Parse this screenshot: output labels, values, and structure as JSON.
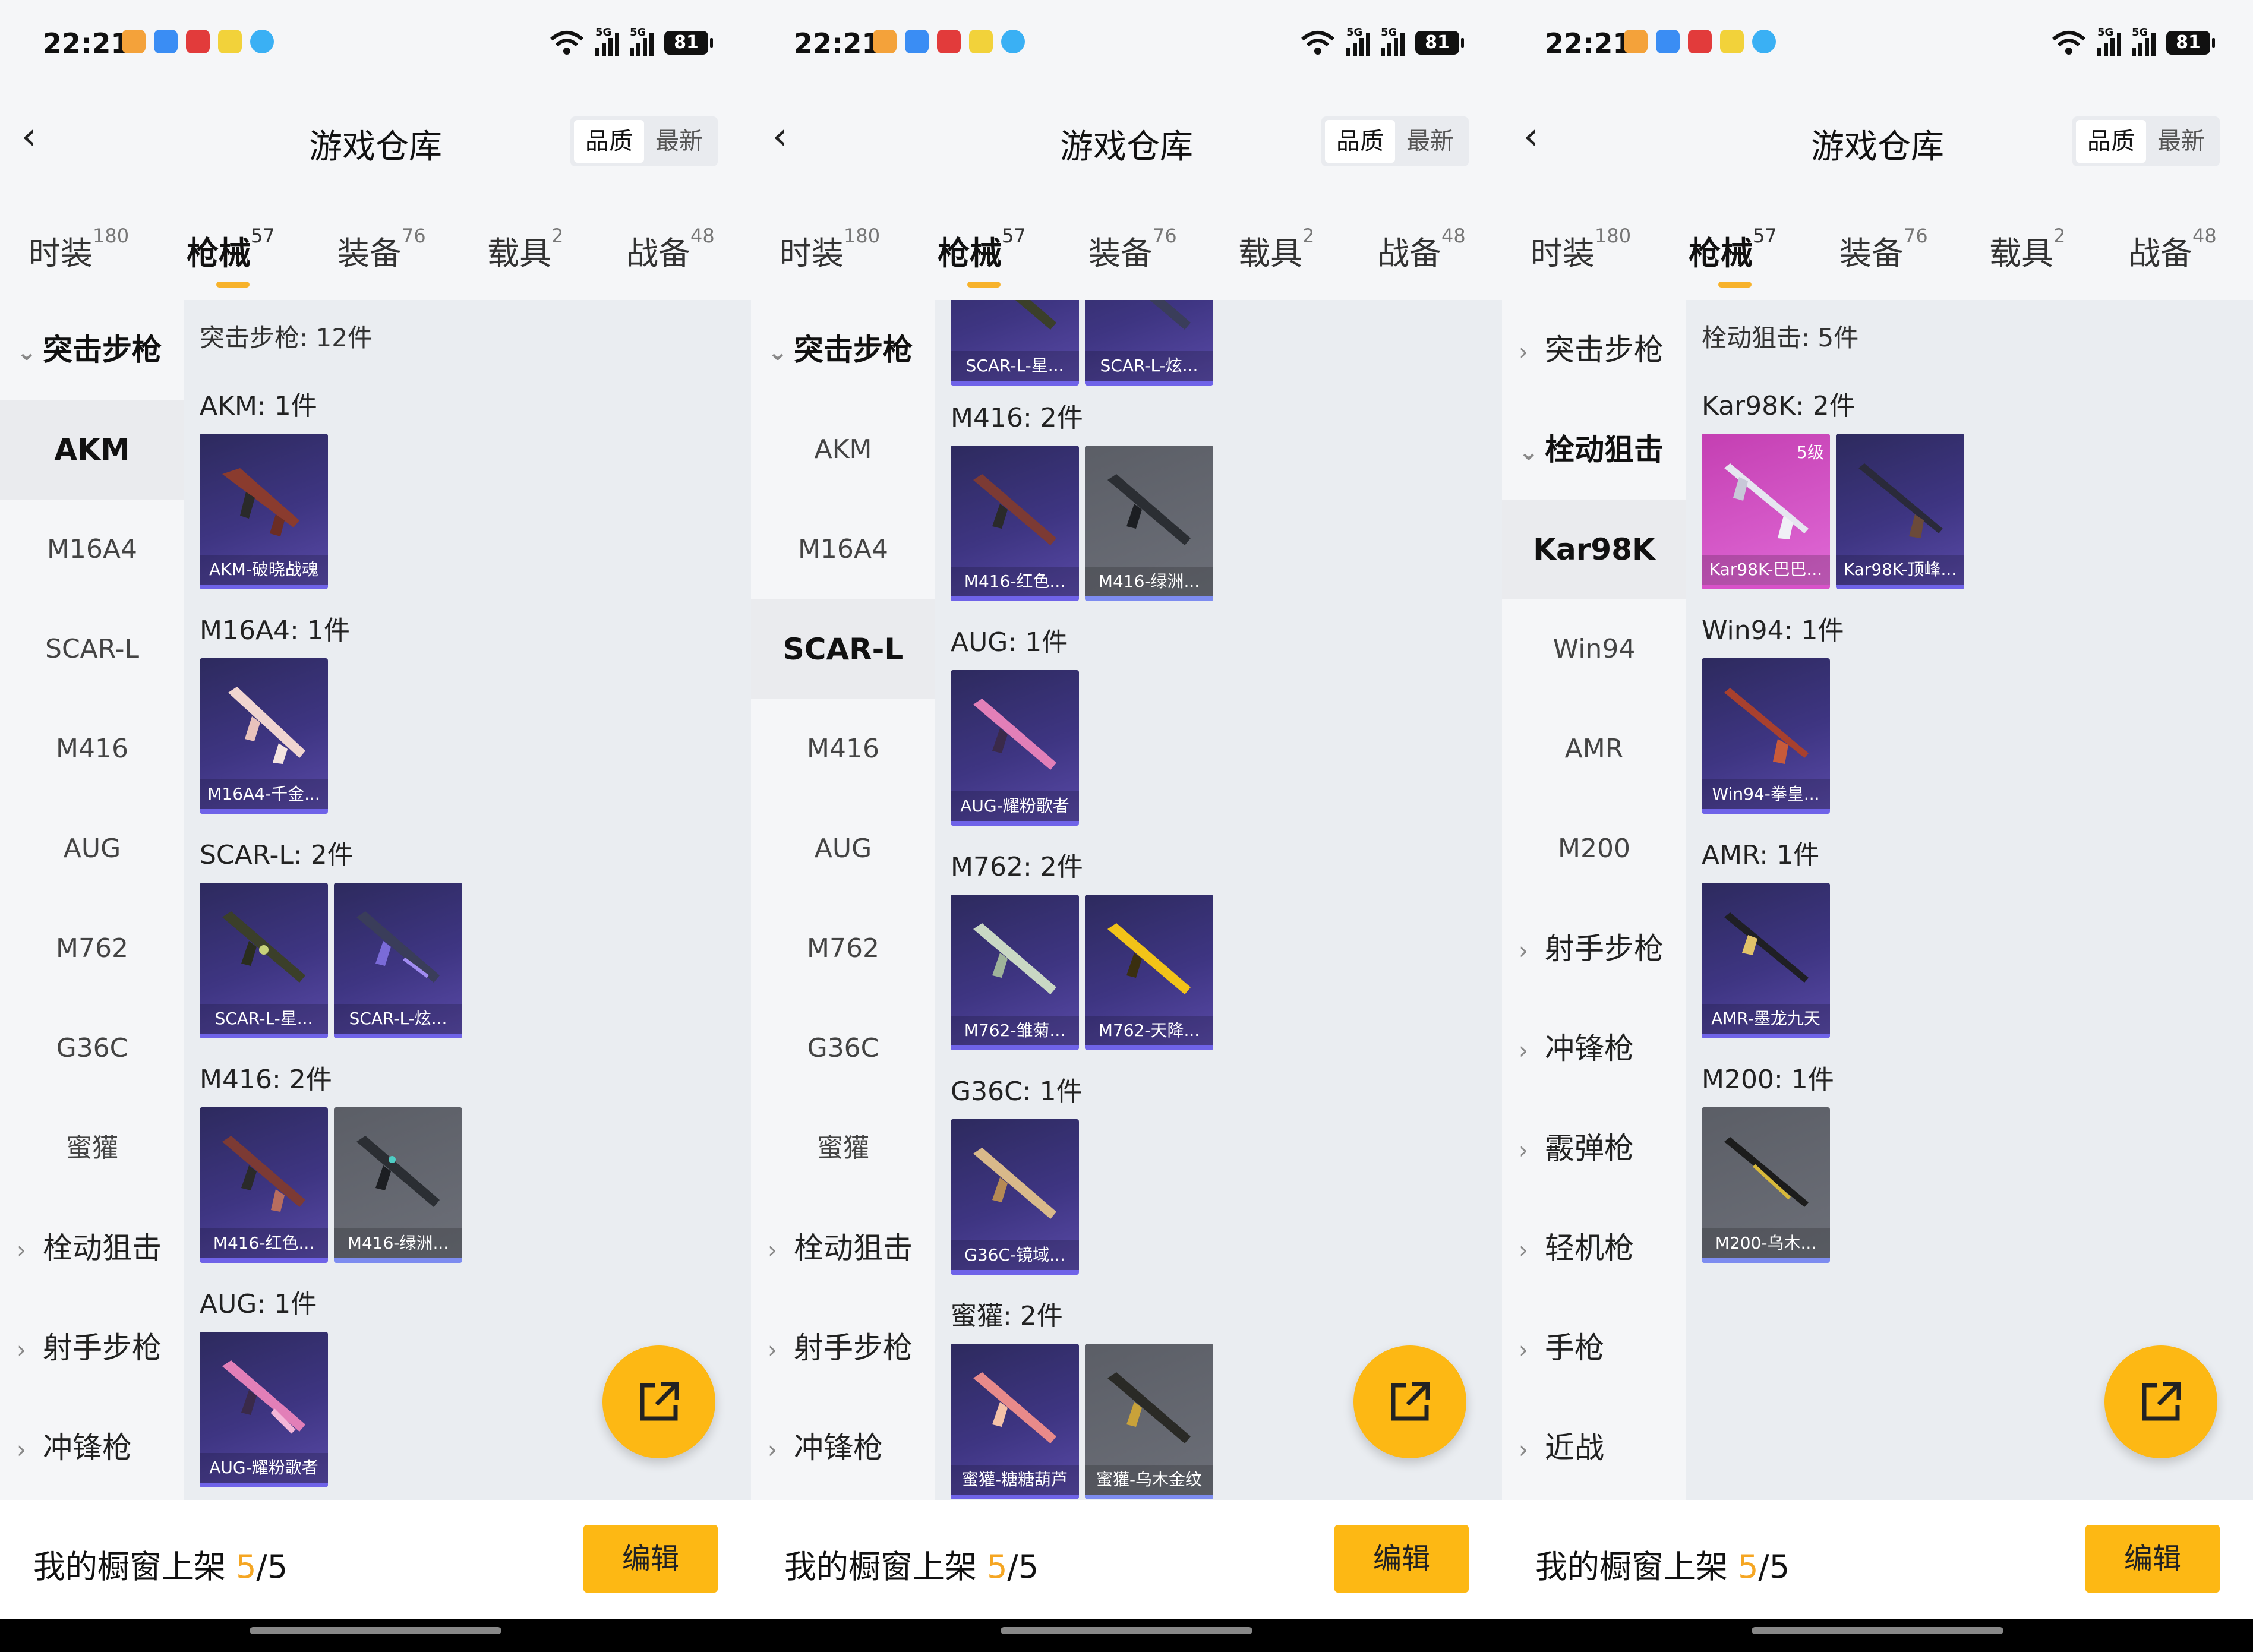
{
  "status": {
    "time": "22:21",
    "battery": "81",
    "signal": "5G"
  },
  "header": {
    "back": "‹",
    "title": "游戏仓库",
    "sort_quality": "品质",
    "sort_latest": "最新"
  },
  "tabs": [
    {
      "label": "时装",
      "count": "180"
    },
    {
      "label": "枪械",
      "count": "57"
    },
    {
      "label": "装备",
      "count": "76"
    },
    {
      "label": "载具",
      "count": "2"
    },
    {
      "label": "战备",
      "count": "48"
    }
  ],
  "colors": {
    "accent": "#fdb814",
    "card_bg": "#3e3582",
    "card_grey": "#6c6f78",
    "card_pink": "#d852c9"
  },
  "bottom": {
    "prefix": "我的橱窗上架 ",
    "count": "5",
    "total": "/5",
    "edit": "编辑"
  },
  "panels": [
    {
      "sidebar": [
        {
          "label": "突击步枪",
          "arrow": "⌄"
        },
        {
          "label": "AKM"
        },
        {
          "label": "M16A4"
        },
        {
          "label": "SCAR-L"
        },
        {
          "label": "M416"
        },
        {
          "label": "AUG"
        },
        {
          "label": "M762"
        },
        {
          "label": "G36C"
        },
        {
          "label": "蜜獾"
        },
        {
          "label": "栓动狙击",
          "arrow": "›"
        },
        {
          "label": "射手步枪",
          "arrow": "›"
        },
        {
          "label": "冲锋枪",
          "arrow": "›"
        }
      ],
      "section": "突击步枪: 12件",
      "groups": [
        {
          "label": "AKM: 1件",
          "items": [
            "AKM-破晓战魂"
          ]
        },
        {
          "label": "M16A4: 1件",
          "items": [
            "M16A4-千金..."
          ]
        },
        {
          "label": "SCAR-L: 2件",
          "items": [
            "SCAR-L-星...",
            "SCAR-L-炫..."
          ]
        },
        {
          "label": "M416: 2件",
          "items": [
            "M416-红色...",
            "M416-绿洲..."
          ]
        },
        {
          "label": "AUG: 1件",
          "items": [
            "AUG-耀粉歌者"
          ]
        }
      ]
    },
    {
      "sidebar": [
        {
          "label": "突击步枪",
          "arrow": "⌄"
        },
        {
          "label": "AKM"
        },
        {
          "label": "M16A4"
        },
        {
          "label": "SCAR-L"
        },
        {
          "label": "M416"
        },
        {
          "label": "AUG"
        },
        {
          "label": "M762"
        },
        {
          "label": "G36C"
        },
        {
          "label": "蜜獾"
        },
        {
          "label": "栓动狙击",
          "arrow": "›"
        },
        {
          "label": "射手步枪",
          "arrow": "›"
        },
        {
          "label": "冲锋枪",
          "arrow": "›"
        }
      ],
      "groups": [
        {
          "label": "",
          "items": [
            "SCAR-L-星...",
            "SCAR-L-炫..."
          ]
        },
        {
          "label": "M416: 2件",
          "items": [
            "M416-红色...",
            "M416-绿洲..."
          ]
        },
        {
          "label": "AUG: 1件",
          "items": [
            "AUG-耀粉歌者"
          ]
        },
        {
          "label": "M762: 2件",
          "items": [
            "M762-雏菊...",
            "M762-天降..."
          ]
        },
        {
          "label": "G36C: 1件",
          "items": [
            "G36C-镜域..."
          ]
        },
        {
          "label": "蜜獾: 2件",
          "items": [
            "蜜獾-糖糖葫芦",
            "蜜獾-乌木金纹"
          ]
        }
      ]
    },
    {
      "sidebar": [
        {
          "label": "突击步枪",
          "arrow": "›"
        },
        {
          "label": "栓动狙击",
          "arrow": "⌄"
        },
        {
          "label": "Kar98K"
        },
        {
          "label": "Win94"
        },
        {
          "label": "AMR"
        },
        {
          "label": "M200"
        },
        {
          "label": "射手步枪",
          "arrow": "›"
        },
        {
          "label": "冲锋枪",
          "arrow": "›"
        },
        {
          "label": "霰弹枪",
          "arrow": "›"
        },
        {
          "label": "轻机枪",
          "arrow": "›"
        },
        {
          "label": "手枪",
          "arrow": "›"
        },
        {
          "label": "近战",
          "arrow": "›"
        }
      ],
      "section": "栓动狙击: 5件",
      "groups": [
        {
          "label": "Kar98K: 2件",
          "items": [
            "Kar98K-巴巴...",
            "Kar98K-顶峰..."
          ],
          "level": "5级"
        },
        {
          "label": "Win94: 1件",
          "items": [
            "Win94-拳皇..."
          ]
        },
        {
          "label": "AMR: 1件",
          "items": [
            "AMR-墨龙九天"
          ]
        },
        {
          "label": "M200: 1件",
          "items": [
            "M200-乌木..."
          ]
        }
      ]
    }
  ]
}
